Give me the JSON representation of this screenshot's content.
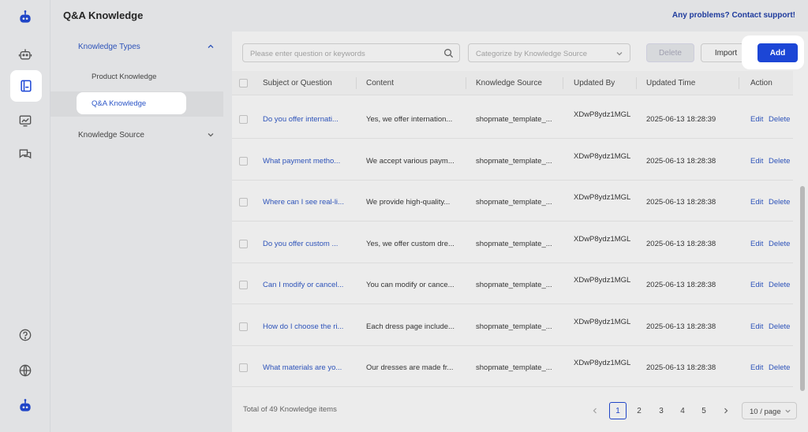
{
  "header": {
    "title": "Q&A Knowledge",
    "help_link": "Any problems? Contact support!"
  },
  "sidebar": {
    "knowledge_types": {
      "label": "Knowledge Types",
      "items": [
        "Product Knowledge",
        "Q&A Knowledge"
      ]
    },
    "knowledge_source": {
      "label": "Knowledge Source"
    }
  },
  "toolbar": {
    "search_placeholder": "Please enter question or keywords",
    "category_placeholder": "Categorize by Knowledge Source",
    "delete_label": "Delete",
    "import_label": "Import",
    "add_label": "Add"
  },
  "table": {
    "columns": [
      "Subject or Question",
      "Content",
      "Knowledge Source",
      "Updated By",
      "Updated Time",
      "Action"
    ],
    "rows": [
      {
        "subject": "Do you offer internati...",
        "content": "Yes, we offer internation...",
        "source": "shopmate_template_...",
        "by": "XDwP8ydz1MGL",
        "time": "2025-06-13 18:28:39"
      },
      {
        "subject": "What payment metho...",
        "content": "We accept various paym...",
        "source": "shopmate_template_...",
        "by": "XDwP8ydz1MGL",
        "time": "2025-06-13 18:28:38"
      },
      {
        "subject": "Where can I see real-li...",
        "content": "We provide high-quality...",
        "source": "shopmate_template_...",
        "by": "XDwP8ydz1MGL",
        "time": "2025-06-13 18:28:38"
      },
      {
        "subject": " Do you offer custom ...",
        "content": "Yes, we offer custom dre...",
        "source": "shopmate_template_...",
        "by": "XDwP8ydz1MGL",
        "time": "2025-06-13 18:28:38"
      },
      {
        "subject": "Can I modify or cancel...",
        "content": "You can modify or cance...",
        "source": "shopmate_template_...",
        "by": "XDwP8ydz1MGL",
        "time": "2025-06-13 18:28:38"
      },
      {
        "subject": "How do I choose the ri...",
        "content": "Each dress page include...",
        "source": "shopmate_template_...",
        "by": "XDwP8ydz1MGL",
        "time": "2025-06-13 18:28:38"
      },
      {
        "subject": "What materials are yo...",
        "content": "Our dresses are made fr...",
        "source": "shopmate_template_...",
        "by": "XDwP8ydz1MGL",
        "time": "2025-06-13 18:28:38"
      }
    ],
    "edit_label": "Edit",
    "delete_label": "Delete"
  },
  "footer": {
    "total": "Total of 49 Knowledge items",
    "pages": [
      "1",
      "2",
      "3",
      "4",
      "5"
    ],
    "page_size": "10 / page"
  },
  "colors": {
    "accent": "#1c46d6",
    "link": "#2b55c7"
  },
  "icons": [
    "robot-logo-icon",
    "bot-icon",
    "knowledge-book-icon",
    "analytics-icon",
    "chat-icon",
    "help-icon",
    "globe-icon",
    "avatar-robot-icon"
  ]
}
